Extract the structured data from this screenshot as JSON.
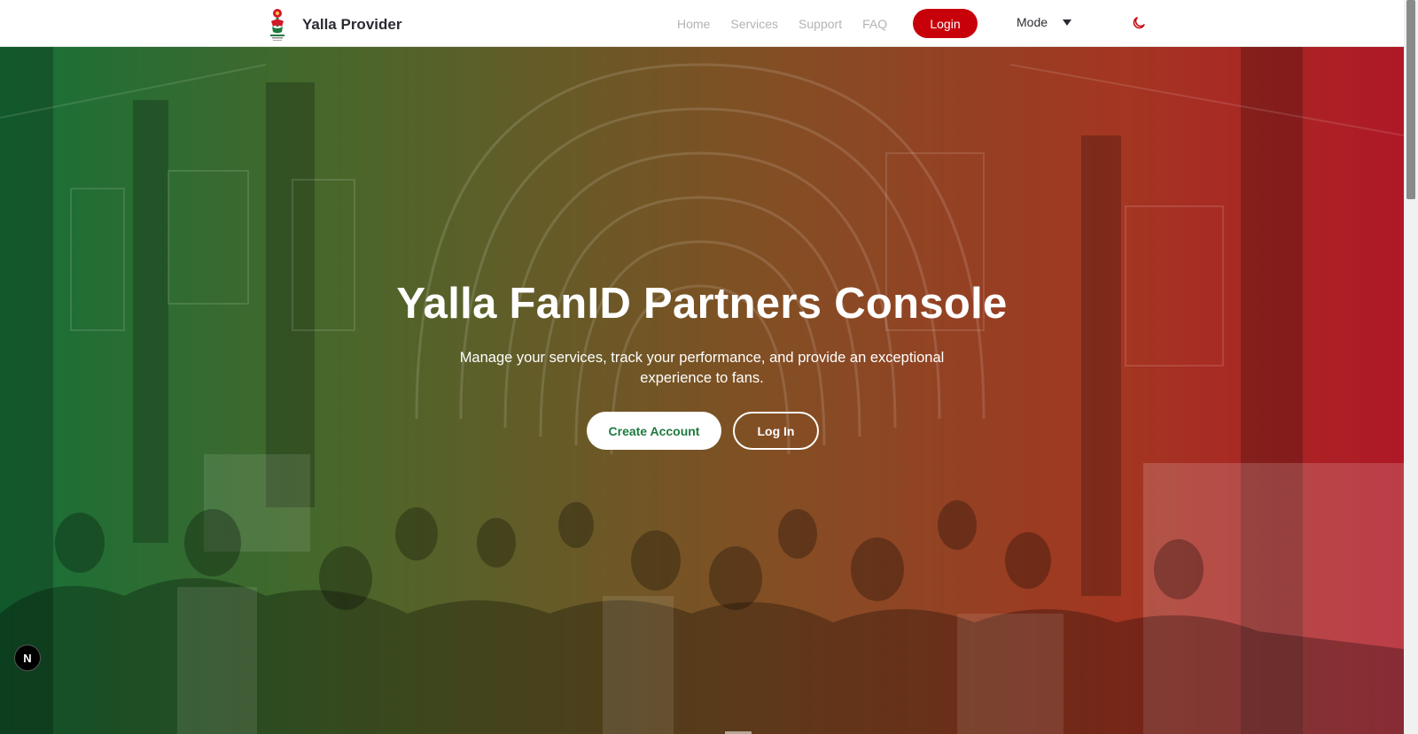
{
  "header": {
    "brand_name": "Yalla Provider",
    "nav": [
      {
        "label": "Home"
      },
      {
        "label": "Services"
      },
      {
        "label": "Support"
      },
      {
        "label": "FAQ"
      }
    ],
    "login_label": "Login",
    "mode_label": "Mode",
    "theme_icon": "moon-icon"
  },
  "hero": {
    "title": "Yalla FanID Partners Console",
    "subtitle": "Manage your services, track your performance, and provide an exceptional experience to fans.",
    "create_account_label": "Create Account",
    "log_in_label": "Log In"
  },
  "dev_badge": {
    "label": "N"
  },
  "colors": {
    "brand_red": "#c8000a",
    "brand_green": "#1e7a3e",
    "gradient_start": "#1b8a45",
    "gradient_end": "#d61e2f"
  }
}
